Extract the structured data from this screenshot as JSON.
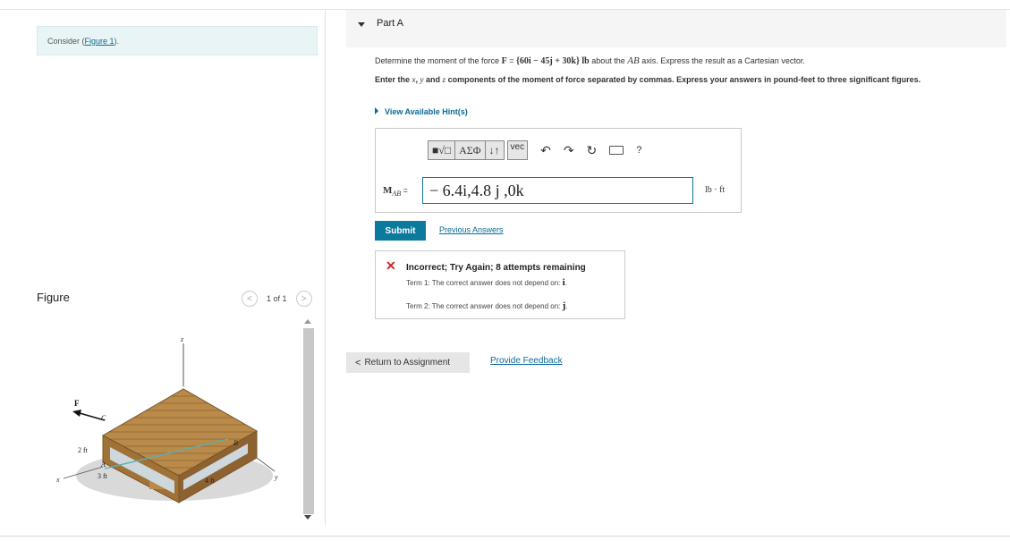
{
  "left": {
    "consider_prefix": "Consider (",
    "figure_link": "Figure 1",
    "consider_suffix": ").",
    "figure_title": "Figure",
    "pager": {
      "prev": "<",
      "count": "1 of 1",
      "next": ">"
    },
    "figure_labels": {
      "z": "z",
      "F": "F",
      "C": "C",
      "B": "B",
      "A": "A",
      "x": "x",
      "y": "y",
      "two_ft": "2 ft",
      "three_ft": "3 ft",
      "four_ft": "4 ft"
    }
  },
  "part": {
    "label": "Part A"
  },
  "question": {
    "prefix": "Determine the moment of the force ",
    "F": "F",
    "eq": " = ",
    "force_expr": "{60i − 45j + 30k} lb",
    "mid": " about the ",
    "axis": "AB",
    "suffix": " axis. Express the result as a Cartesian vector."
  },
  "instruction": {
    "p1": "Enter the ",
    "x": "x",
    "comma1": ", ",
    "y": "y",
    "and": " and ",
    "z": "z",
    "p2": " components of the moment of force separated  by commas. Express your answers in pound-feet to three significant figures."
  },
  "hint_label": "View Available Hint(s)",
  "toolbar": {
    "template_btn": "■√□",
    "greek_btn": "ΑΣΦ",
    "swap_btn": "↓↑",
    "vec_btn": "vec",
    "undo_icon": "↶",
    "redo_icon": "↷",
    "reset_icon": "↻",
    "help": "?"
  },
  "answer": {
    "M": "M",
    "sub": "AB",
    "equals": " =",
    "value": "− 6.4i,4.8 j ,0k",
    "unit": "lb · ft"
  },
  "buttons": {
    "submit": "Submit",
    "previous_answers": "Previous Answers"
  },
  "feedback": {
    "x": "✕",
    "message": "Incorrect; Try Again; 8 attempts remaining",
    "term1": "Term 1: The correct answer does not depend on: ",
    "term1_var": "i",
    "term1_end": ".",
    "term2": "Term 2: The correct answer does not depend on: ",
    "term2_var": "j",
    "term2_end": "."
  },
  "footer": {
    "chevron": "<",
    "return": "Return to Assignment",
    "provide_feedback": "Provide Feedback"
  }
}
